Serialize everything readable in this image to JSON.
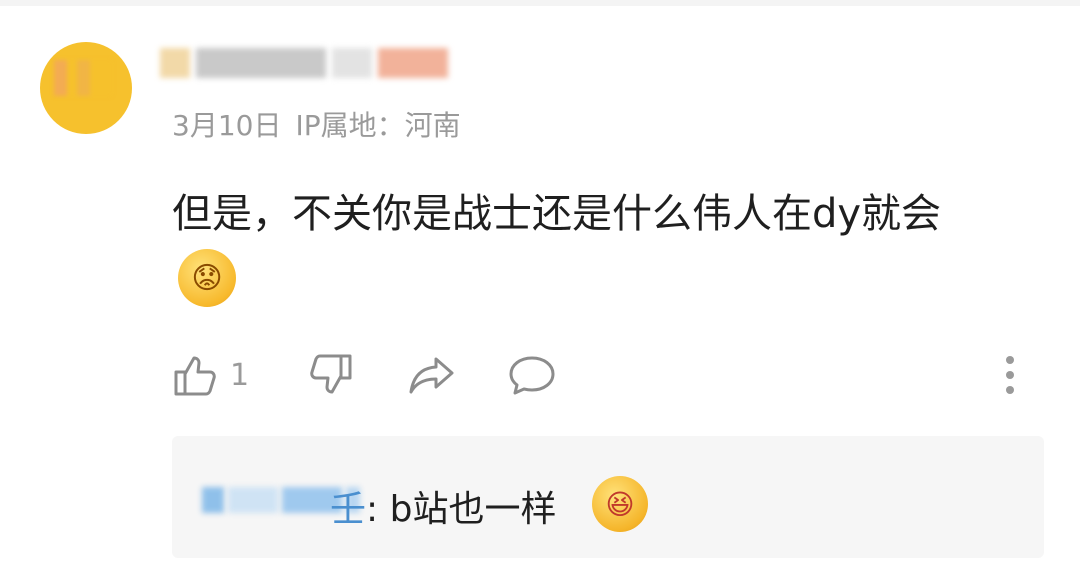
{
  "comment": {
    "date": "3月10日",
    "ip_label": "IP属地：",
    "ip_location": "河南",
    "text": "但是，不关你是战士还是什么伟人在dy就会",
    "emoji": "thinking-face-emoji",
    "like_count": "1"
  },
  "actions": {
    "like_icon": "thumbs-up-icon",
    "dislike_icon": "thumbs-down-icon",
    "share_icon": "share-icon",
    "reply_icon": "comment-icon",
    "more_icon": "more-vertical-icon"
  },
  "reply": {
    "author_tail": "壬",
    "separator": ":",
    "text": " b站也一样",
    "emoji": "laughing-face-emoji"
  },
  "colors": {
    "avatar": "#f6c12d",
    "meta_text": "#9a9a9a",
    "link_blue": "#4a8fcf",
    "reply_bg": "#f6f6f6"
  }
}
